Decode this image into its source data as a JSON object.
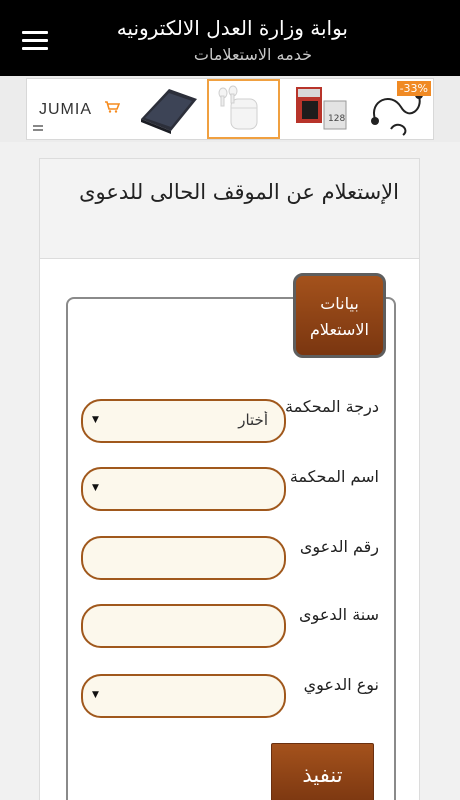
{
  "header": {
    "title": "بوابة وزارة العدل الالكترونيه",
    "subtitle": "خدمه الاستعلامات"
  },
  "ads": {
    "brand": "JUMIA",
    "discount": "-33%",
    "items": [
      "tablet-case",
      "wireless-earbuds",
      "memory-card",
      "wired-earphones"
    ]
  },
  "page": {
    "title": "الإستعلام عن الموقف الحالى للدعوى"
  },
  "form": {
    "legend": "بيانات الاستعلام",
    "fields": [
      {
        "label": "درجة المحكمة",
        "value": "أختار",
        "type": "select"
      },
      {
        "label": "اسم المحكمة",
        "value": "",
        "type": "select"
      },
      {
        "label": "رقم الدعوى",
        "value": "",
        "type": "text"
      },
      {
        "label": "سنة الدعوى",
        "value": "",
        "type": "text"
      },
      {
        "label": "نوع الدعوي",
        "value": "",
        "type": "select"
      }
    ],
    "submit_label": "تنفيذ"
  },
  "colors": {
    "accent": "#8a4216",
    "field_bg": "#fcf8ec",
    "appbar": "#000000"
  }
}
